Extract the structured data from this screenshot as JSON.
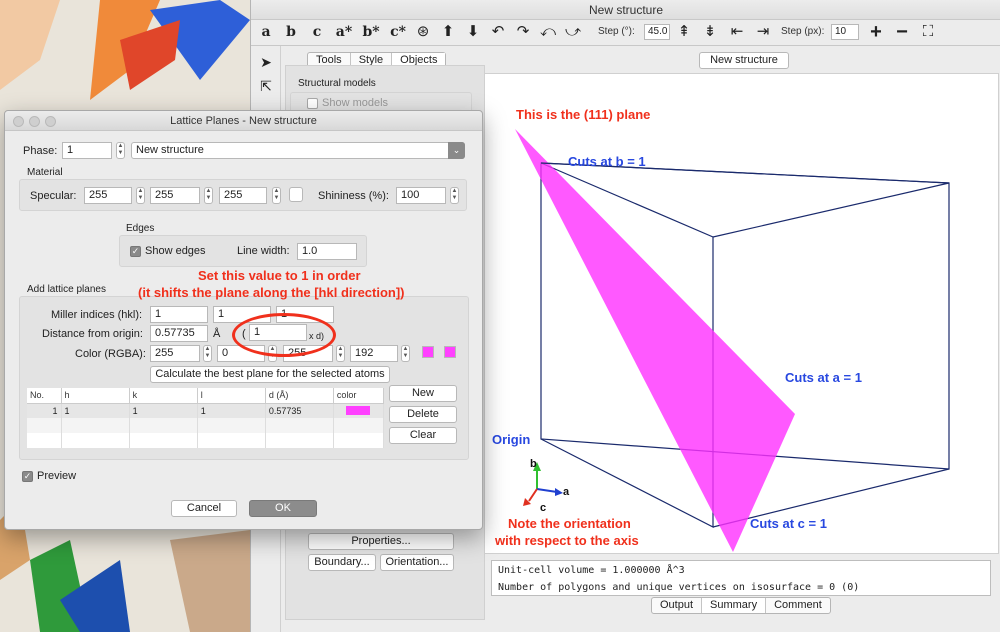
{
  "main_window": {
    "title": "New structure",
    "toolbar": {
      "axis_buttons": [
        "a",
        "b",
        "c",
        "a*",
        "b*",
        "c*"
      ],
      "step_deg_label": "Step (°):",
      "step_deg_value": "45.0",
      "step_px_label": "Step (px):",
      "step_px_value": "10"
    },
    "side_tabs": [
      "Tools",
      "Style",
      "Objects"
    ],
    "side_tabs_selected": "Objects",
    "structural_models_label": "Structural models",
    "show_models_label": "Show models",
    "properties_button": "Properties...",
    "boundary_button": "Boundary...",
    "orientation_button": "Orientation...",
    "viewport_tab": "New structure",
    "output_lines": [
      "Unit-cell volume = 1.000000 Å^3",
      "Number of polygons and unique vertices on isosurface = 0 (0)"
    ],
    "bottom_tabs": [
      "Output",
      "Summary",
      "Comment"
    ]
  },
  "dialog": {
    "title": "Lattice Planes - New structure",
    "phase_label": "Phase:",
    "phase_value": "1",
    "phase_name": "New structure",
    "material_label": "Material",
    "specular_label": "Specular:",
    "specular_values": [
      "255",
      "255",
      "255"
    ],
    "shininess_label": "Shininess (%):",
    "shininess_value": "100",
    "edges_label": "Edges",
    "show_edges_label": "Show edges",
    "line_width_label": "Line width:",
    "line_width_value": "1.0",
    "add_planes_label": "Add lattice planes",
    "miller_label": "Miller indices (hkl):",
    "miller_values": [
      "1",
      "1",
      "1"
    ],
    "distance_label": "Distance from origin:",
    "distance_value": "0.57735",
    "distance_unit": "Å",
    "d_multiplier_open": "(",
    "d_multiplier_value": "1",
    "d_multiplier_unit": "x d)",
    "color_label": "Color (RGBA):",
    "color_values": [
      "255",
      "0",
      "255",
      "192"
    ],
    "calc_button": "Calculate the best plane for the selected atoms",
    "table_headers": [
      "No.",
      "h",
      "k",
      "l",
      "d (Å)",
      "color"
    ],
    "table_rows": [
      [
        "1",
        "1",
        "1",
        "1",
        "0.57735"
      ]
    ],
    "new_button": "New",
    "delete_button": "Delete",
    "clear_button": "Clear",
    "preview_label": "Preview",
    "cancel_button": "Cancel",
    "ok_button": "OK",
    "plane_color": "#ff40ff"
  },
  "annotations": {
    "plane_label": "This is the (111) plane",
    "cut_b": "Cuts at b = 1",
    "cut_a": "Cuts at a = 1",
    "cut_c": "Cuts at c = 1",
    "origin": "Origin",
    "note_line1": "Note the orientation",
    "note_line2": "with respect to the axis",
    "set_value_line1": "Set this value to 1 in order",
    "set_value_line2": "(it shifts the plane along the [hkl direction])",
    "axis_b": "b",
    "axis_a": "a",
    "axis_c": "c",
    "red": "#f0301c",
    "blue": "#2848e0"
  }
}
